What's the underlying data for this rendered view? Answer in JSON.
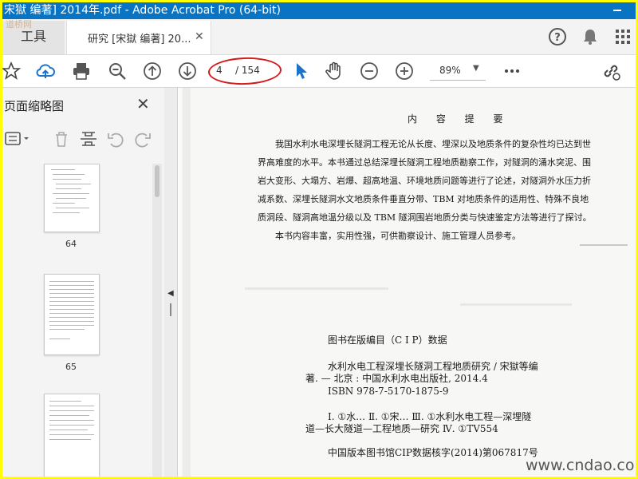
{
  "window": {
    "title": "宋獄 编著] 2014年.pdf - Adobe Acrobat Pro (64-bit)"
  },
  "tabs": {
    "tools_label": "工具",
    "doc_tab_label": "研究 [宋獄 编著] 20...",
    "watermark_left": "道桥网"
  },
  "toolbar": {
    "current_page": "4",
    "total_pages": "/ 154",
    "zoom": "89%"
  },
  "sidebar": {
    "title": "页面缩略图",
    "thumbnails": [
      "64",
      "65"
    ]
  },
  "document": {
    "heading": "内 容 提 要",
    "summary_lines": [
      "我国水利水电深埋长隧洞工程无论从长度、埋深以及地质条件的复杂性均已达到世",
      "界高难度的水平。本书通过总结深埋长隧洞工程地质勘察工作，对隧洞的涌水突泥、围",
      "岩大变形、大塌方、岩爆、超高地温、环境地质问题等进行了论述，对隧洞外水压力折",
      "减系数、深埋长隧洞水文地质条件垂直分带、TBM 对地质条件的适用性、特殊不良地",
      "质洞段、隧洞高地温分级以及 TBM 隧洞围岩地质分类与快速鉴定方法等进行了探讨。",
      "本书内容丰富，实用性强，可供勘察设计、施工管理人员参考。"
    ],
    "cip_heading": "图书在版编目（C I P）数据",
    "cip_lines": [
      "水利水电工程深埋长隧洞工程地质研究 / 宋獄等编",
      "著. — 北京 : 中国水利水电出版社, 2014.4",
      "ISBN 978-7-5170-1875-9",
      "Ⅰ. ①水… Ⅱ. ①宋… Ⅲ. ①水利水电工程—深埋隧",
      "道—长大隧道—工程地质—研究 Ⅳ. ①TV554",
      "中国版本图书馆CIP数据核字(2014)第067817号"
    ],
    "watermark": "www.cndao.com"
  }
}
